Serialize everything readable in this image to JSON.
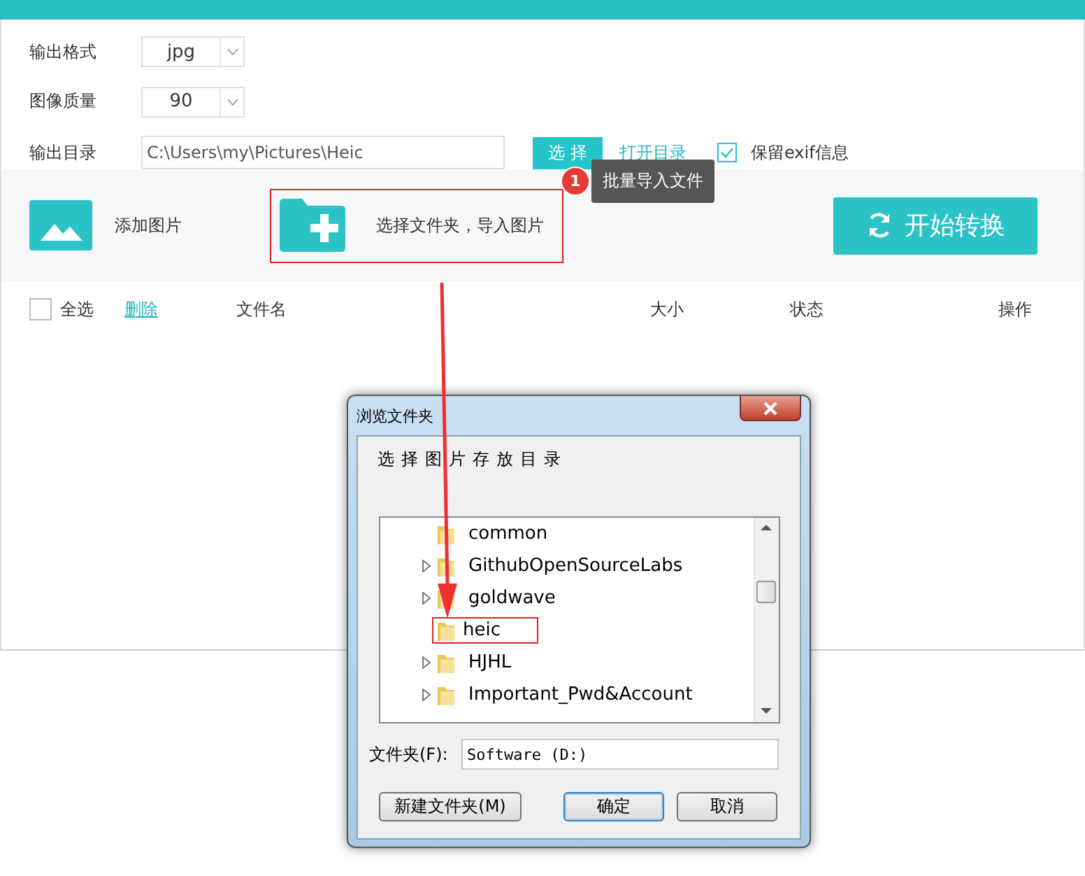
{
  "app": {
    "settings": [
      {
        "label": "输出格式",
        "kind": "dropdown",
        "value": "jpg"
      },
      {
        "label": "图像质量",
        "kind": "dropdown",
        "value": "90"
      },
      {
        "label": "输出目录",
        "kind": "path",
        "value": "C:\\Users\\my\\Pictures\\Heic"
      }
    ],
    "choose_button": "选 择",
    "open_dir_link": "打开目录",
    "keep_exif": {
      "label": "保留exif信息",
      "checked": true
    },
    "tooltip": {
      "badge": "1",
      "text": "批量导入文件"
    },
    "toolbar": {
      "add_image": "添加图片",
      "add_folder": {
        "label": "选择文件夹，导入图片",
        "highlighted": true
      },
      "start": "开始转换"
    },
    "table": {
      "select_all": {
        "label": "全选",
        "checked": false
      },
      "delete_link": "删除",
      "columns": [
        "文件名",
        "大小",
        "状态",
        "操作"
      ]
    }
  },
  "dialog": {
    "title": "浏览文件夹",
    "prompt": "选择图片存放目录",
    "tree": [
      {
        "label": "common",
        "expandable": false,
        "highlighted": false
      },
      {
        "label": "GithubOpenSourceLabs",
        "expandable": true,
        "highlighted": false
      },
      {
        "label": "goldwave",
        "expandable": true,
        "highlighted": false
      },
      {
        "label": "heic",
        "expandable": false,
        "highlighted": true
      },
      {
        "label": "HJHL",
        "expandable": true,
        "highlighted": false
      },
      {
        "label": "Important_Pwd&Account",
        "expandable": true,
        "highlighted": false
      }
    ],
    "folder_label": "文件夹(F):",
    "folder_value": "Software (D:)",
    "buttons": [
      {
        "label": "新建文件夹(M)",
        "default": false
      },
      {
        "label": "确定",
        "default": true
      },
      {
        "label": "取消",
        "default": false
      }
    ]
  }
}
